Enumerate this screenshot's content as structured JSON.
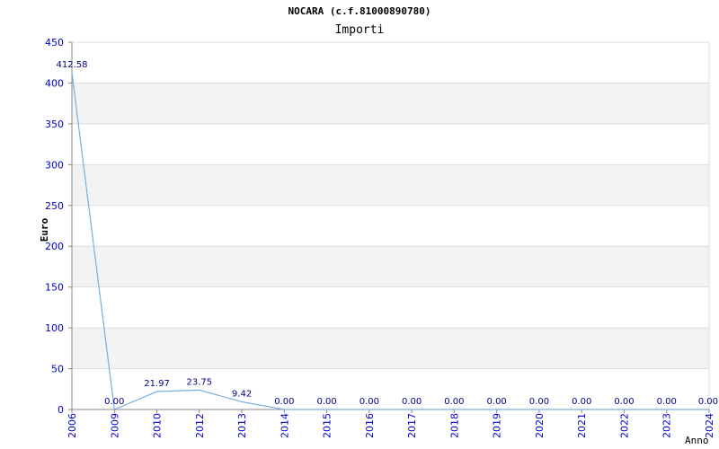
{
  "chart_data": {
    "type": "line",
    "title": "NOCARA (c.f.81000890780)",
    "subtitle": "Importi",
    "xlabel": "Anno",
    "ylabel": "Euro",
    "ylim": [
      0,
      450
    ],
    "yticks": [
      0,
      50,
      100,
      150,
      200,
      250,
      300,
      350,
      400,
      450
    ],
    "grid": true,
    "categories": [
      "2006",
      "2009",
      "2010",
      "2012",
      "2013",
      "2014",
      "2015",
      "2016",
      "2017",
      "2018",
      "2019",
      "2020",
      "2021",
      "2022",
      "2023",
      "2024"
    ],
    "values": [
      412.58,
      0.0,
      21.97,
      23.75,
      9.42,
      0.0,
      0.0,
      0.0,
      0.0,
      0.0,
      0.0,
      0.0,
      0.0,
      0.0,
      0.0,
      0.0
    ],
    "value_labels": [
      "412.58",
      "0.00",
      "21.97",
      "23.75",
      "9.42",
      "0.00",
      "0.00",
      "0.00",
      "0.00",
      "0.00",
      "0.00",
      "0.00",
      "0.00",
      "0.00",
      "0.00",
      "0.00"
    ],
    "colors": {
      "line": "#7aaee0",
      "band": "#f3f3f3",
      "grid": "#dddddd",
      "tick_text": "#0000cc",
      "label_text": "#000080",
      "title_text": "#000000"
    }
  }
}
